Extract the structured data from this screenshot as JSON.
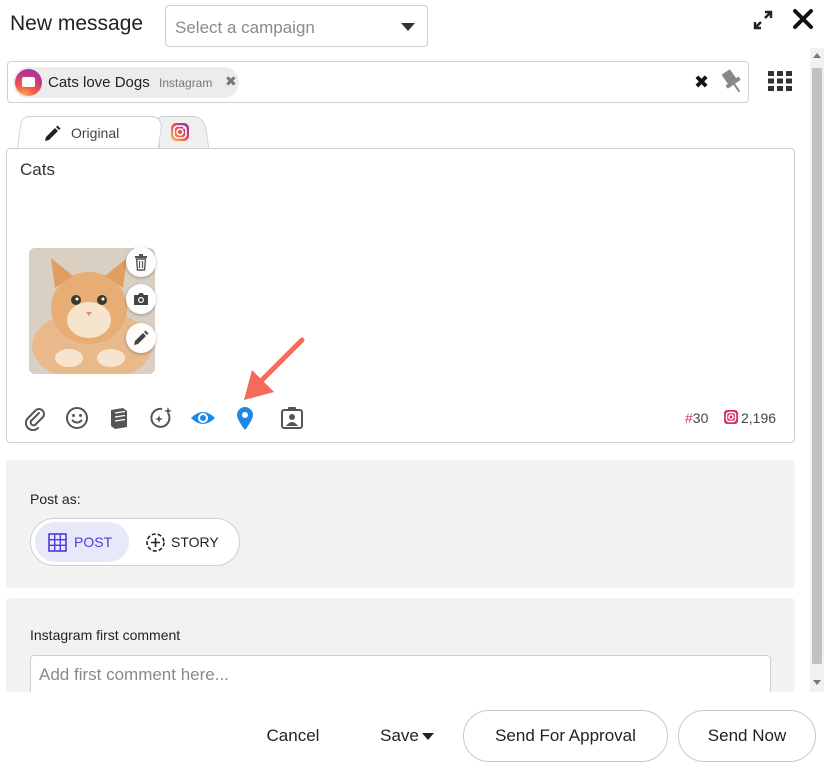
{
  "header": {
    "title": "New message",
    "campaign_placeholder": "Select a campaign"
  },
  "profiles": {
    "selected": [
      {
        "name": "Cats love Dogs",
        "network": "Instagram"
      }
    ]
  },
  "tabs": [
    {
      "label": "Original",
      "icon": "pencil-icon",
      "active": true
    },
    {
      "label": "",
      "icon": "instagram-icon",
      "active": false
    }
  ],
  "editor": {
    "text": "Cats",
    "media": {
      "alt": "cat photo",
      "actions": [
        "trash-icon",
        "camera-icon",
        "pencil-icon"
      ]
    },
    "toolbar": [
      "attachment-icon",
      "emoji-icon",
      "library-icon",
      "ai-sparkle-icon",
      "preview-eye-icon",
      "location-pin-icon",
      "tag-person-icon"
    ],
    "hashtag_symbol": "#",
    "hashtag_count": "30",
    "char_count": "2,196"
  },
  "post_as": {
    "label": "Post as:",
    "options": [
      "POST",
      "STORY"
    ],
    "selected": "POST"
  },
  "first_comment": {
    "label": "Instagram first comment",
    "placeholder": "Add first comment here...",
    "value": ""
  },
  "footer": {
    "cancel": "Cancel",
    "save": "Save",
    "send_for_approval": "Send For Approval",
    "send_now": "Send Now"
  },
  "colors": {
    "accent": "#4a3fd6",
    "accent_bg": "#e8e8fb",
    "toolbar_active": "#1e88e5",
    "hashtag": "#d6336c",
    "annotation_arrow": "#f26b5b"
  }
}
